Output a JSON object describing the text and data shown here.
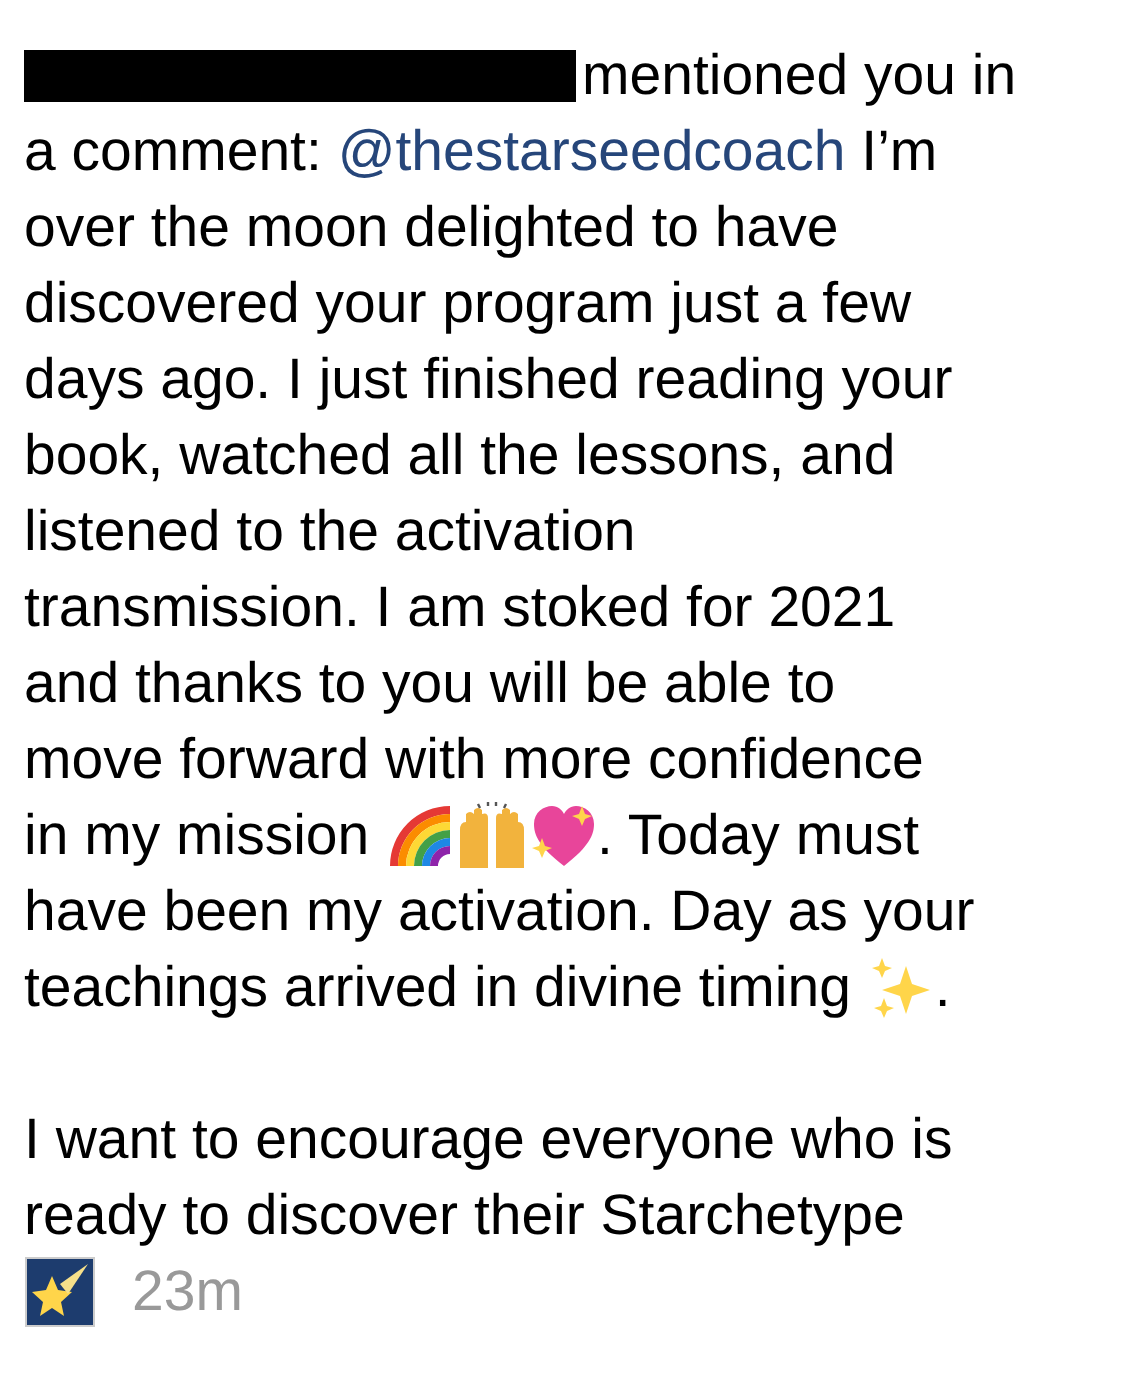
{
  "notification": {
    "paragraphs": [
      {
        "lines": [
          [
            {
              "kind": "redacted"
            },
            {
              "kind": "text",
              "text": "mentioned you in"
            }
          ],
          [
            {
              "kind": "text",
              "text": "a comment: "
            },
            {
              "kind": "mention",
              "text": "@thestarseedcoach"
            },
            {
              "kind": "text",
              "text": " I’m"
            }
          ],
          [
            {
              "kind": "text",
              "text": "over the moon delighted to have"
            }
          ],
          [
            {
              "kind": "text",
              "text": "discovered your program just a few"
            }
          ],
          [
            {
              "kind": "text",
              "text": "days ago. I just finished reading your"
            }
          ],
          [
            {
              "kind": "text",
              "text": "book, watched all the lessons, and"
            }
          ],
          [
            {
              "kind": "text",
              "text": "listened to the activation"
            }
          ],
          [
            {
              "kind": "text",
              "text": "transmission. I am stoked for 2021"
            }
          ],
          [
            {
              "kind": "text",
              "text": "and thanks to you will be able to"
            }
          ],
          [
            {
              "kind": "text",
              "text": "move forward with more confidence"
            }
          ],
          [
            {
              "kind": "text",
              "text": "in my mission "
            },
            {
              "kind": "rainbow"
            },
            {
              "kind": "hands"
            },
            {
              "kind": "heart"
            },
            {
              "kind": "text",
              "text": ". Today must"
            }
          ],
          [
            {
              "kind": "text",
              "text": "have been my activation. Day as your"
            }
          ],
          [
            {
              "kind": "text",
              "text": "teachings arrived in divine timing "
            },
            {
              "kind": "sparkles"
            },
            {
              "kind": "text",
              "text": "."
            }
          ]
        ]
      },
      {
        "lines": [
          [
            {
              "kind": "text",
              "text": "I want to encourage everyone who is"
            }
          ],
          [
            {
              "kind": "text",
              "text": "ready to discover their Starchetype"
            }
          ],
          [
            {
              "kind": "star"
            },
            {
              "kind": "time",
              "text": "23m"
            }
          ]
        ]
      }
    ]
  }
}
